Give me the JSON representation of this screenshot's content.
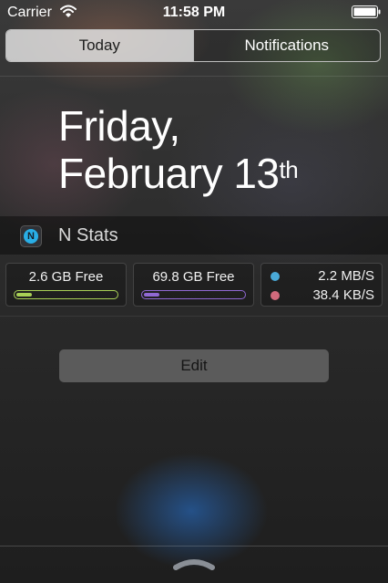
{
  "status_bar": {
    "carrier": "Carrier",
    "time": "11:58 PM",
    "wifi_icon": "wifi-icon",
    "battery_icon": "battery-icon"
  },
  "tabs": [
    {
      "label": "Today",
      "selected": true
    },
    {
      "label": "Notifications",
      "selected": false
    }
  ],
  "date": {
    "line1": "Friday,",
    "line2": "February 13",
    "suffix": "th"
  },
  "widget": {
    "title": "N Stats",
    "icon_letter": "N",
    "icon": "nstats-app-icon",
    "stats": [
      {
        "value": "2.6 GB Free",
        "fill": 0.15,
        "color": "#a8d056"
      },
      {
        "value": "69.8 GB Free",
        "fill": 0.15,
        "color": "#9069d3"
      }
    ],
    "network": [
      {
        "value": "2.2 MB/S",
        "color": "#4aaad8"
      },
      {
        "value": "38.4 KB/S",
        "color": "#d06a7c"
      }
    ]
  },
  "edit_label": "Edit",
  "grabber_icon": "chevron-up-icon",
  "colors": {
    "segment_border": "#bdbdbd",
    "edit_button": "#5b5b5b"
  }
}
